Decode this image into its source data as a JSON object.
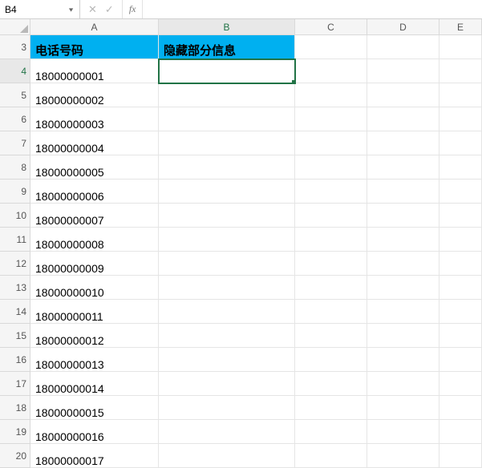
{
  "formula_bar": {
    "name_box_value": "B4",
    "cancel_icon": "✕",
    "confirm_icon": "✓",
    "fx_label": "fx",
    "formula_value": ""
  },
  "columns": [
    "A",
    "B",
    "C",
    "D",
    "E"
  ],
  "row_start": 3,
  "header_row": {
    "a": "电话号码",
    "b": "隐藏部分信息"
  },
  "rows": [
    {
      "n": 4,
      "a": "18000000001",
      "b": ""
    },
    {
      "n": 5,
      "a": "18000000002",
      "b": ""
    },
    {
      "n": 6,
      "a": "18000000003",
      "b": ""
    },
    {
      "n": 7,
      "a": "18000000004",
      "b": ""
    },
    {
      "n": 8,
      "a": "18000000005",
      "b": ""
    },
    {
      "n": 9,
      "a": "18000000006",
      "b": ""
    },
    {
      "n": 10,
      "a": "18000000007",
      "b": ""
    },
    {
      "n": 11,
      "a": "18000000008",
      "b": ""
    },
    {
      "n": 12,
      "a": "18000000009",
      "b": ""
    },
    {
      "n": 13,
      "a": "18000000010",
      "b": ""
    },
    {
      "n": 14,
      "a": "18000000011",
      "b": ""
    },
    {
      "n": 15,
      "a": "18000000012",
      "b": ""
    },
    {
      "n": 16,
      "a": "18000000013",
      "b": ""
    },
    {
      "n": 17,
      "a": "18000000014",
      "b": ""
    },
    {
      "n": 18,
      "a": "18000000015",
      "b": ""
    },
    {
      "n": 19,
      "a": "18000000016",
      "b": ""
    },
    {
      "n": 20,
      "a": "18000000017",
      "b": ""
    }
  ],
  "selected_cell": "B4",
  "colors": {
    "header_fill": "#00b0f0",
    "selection": "#217346"
  }
}
